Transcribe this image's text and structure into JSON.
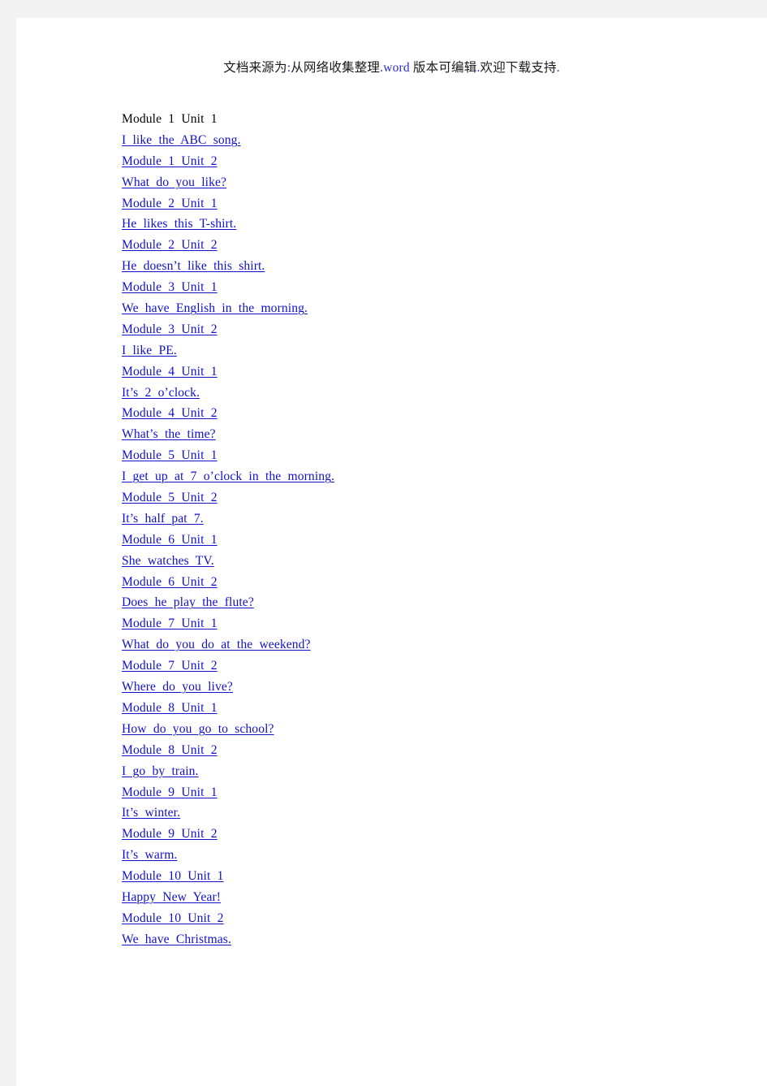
{
  "document": {
    "background_color": "#f3f3f4",
    "page_color": "#ffffff",
    "link_color": "#1111cc",
    "text_color": "#000000"
  },
  "header": {
    "full_text": "文档来源为:从网络收集整理.word 版本可编辑.欢迎下载支持.",
    "segments": [
      {
        "text": "文档来源为",
        "color": "#1a1a1a",
        "highlight": false
      },
      {
        "text": ":",
        "color": "#2a2ad0",
        "highlight": true
      },
      {
        "text": "从网络收集整理",
        "color": "#1a1a1a",
        "highlight": false
      },
      {
        "text": ".",
        "color": "#2a2ad0",
        "highlight": true
      },
      {
        "text": "word",
        "color": "#2a2ad0",
        "highlight": true
      },
      {
        "text": " 版本可编辑",
        "color": "#1a1a1a",
        "highlight": false
      },
      {
        "text": ".",
        "color": "#2a2ad0",
        "highlight": true
      },
      {
        "text": "欢迎下载支持",
        "color": "#1a1a1a",
        "highlight": false
      },
      {
        "text": ".",
        "color": "#2a2ad0",
        "highlight": true
      }
    ]
  },
  "toc": {
    "lines": [
      {
        "text": "Module 1 Unit 1",
        "is_link": false
      },
      {
        "text": "I like the ABC song.",
        "is_link": true
      },
      {
        "text": "Module 1 Unit 2",
        "is_link": true
      },
      {
        "text": "What do you like?",
        "is_link": true
      },
      {
        "text": "Module 2 Unit 1",
        "is_link": true
      },
      {
        "text": "He likes this T-shirt.",
        "is_link": true
      },
      {
        "text": "Module 2 Unit 2",
        "is_link": true
      },
      {
        "text": "He doesn’t like this shirt.",
        "is_link": true
      },
      {
        "text": "Module 3 Unit 1",
        "is_link": true
      },
      {
        "text": "We have English in the morning.",
        "is_link": true
      },
      {
        "text": "Module 3 Unit 2",
        "is_link": true
      },
      {
        "text": "I like PE.",
        "is_link": true
      },
      {
        "text": "Module 4 Unit 1",
        "is_link": true
      },
      {
        "text": "It’s 2 o’clock.",
        "is_link": true
      },
      {
        "text": "Module 4 Unit 2",
        "is_link": true
      },
      {
        "text": "What’s the time?",
        "is_link": true
      },
      {
        "text": "Module 5 Unit 1",
        "is_link": true
      },
      {
        "text": "I get up at 7 o’clock in the morning.",
        "is_link": true
      },
      {
        "text": "Module 5 Unit 2",
        "is_link": true
      },
      {
        "text": "It’s half pat 7.",
        "is_link": true
      },
      {
        "text": "Module 6 Unit 1",
        "is_link": true
      },
      {
        "text": "She watches TV.",
        "is_link": true
      },
      {
        "text": "Module 6 Unit 2",
        "is_link": true
      },
      {
        "text": "Does he play the flute?",
        "is_link": true
      },
      {
        "text": "Module 7 Unit 1",
        "is_link": true
      },
      {
        "text": "What do you do at the weekend?",
        "is_link": true
      },
      {
        "text": "Module 7 Unit 2",
        "is_link": true
      },
      {
        "text": "Where do you live?",
        "is_link": true
      },
      {
        "text": "Module 8 Unit 1",
        "is_link": true
      },
      {
        "text": "How do you go to school?",
        "is_link": true
      },
      {
        "text": "Module 8 Unit 2",
        "is_link": true
      },
      {
        "text": "I go by train.",
        "is_link": true
      },
      {
        "text": "Module 9 Unit 1",
        "is_link": true
      },
      {
        "text": "It’s winter.",
        "is_link": true
      },
      {
        "text": "Module 9 Unit 2",
        "is_link": true
      },
      {
        "text": "It’s warm.",
        "is_link": true
      },
      {
        "text": "Module 10 Unit 1",
        "is_link": true
      },
      {
        "text": "Happy New Year!",
        "is_link": true
      },
      {
        "text": "Module 10 Unit 2",
        "is_link": true
      },
      {
        "text": "We have Christmas.",
        "is_link": true
      }
    ]
  }
}
